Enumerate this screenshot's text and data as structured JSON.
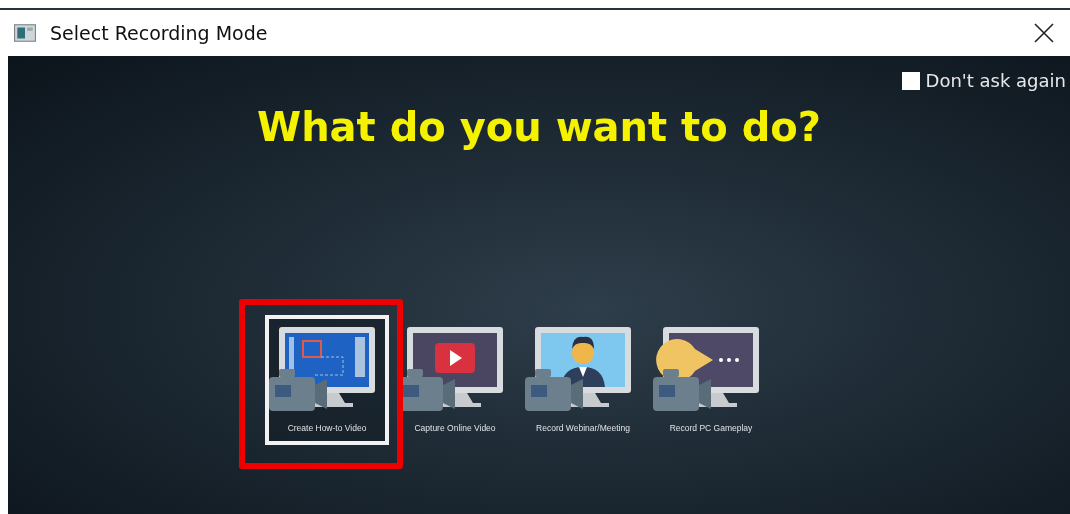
{
  "window": {
    "title": "Select Recording Mode"
  },
  "dont_ask": {
    "label": "Don't ask again",
    "checked": false
  },
  "heading": "What do you want to do?",
  "modes": [
    {
      "label": "Create How-to Video",
      "kind": "howto",
      "selected": true,
      "highlighted": true
    },
    {
      "label": "Capture Online Video",
      "kind": "online",
      "selected": false,
      "highlighted": false
    },
    {
      "label": "Record Webinar/Meeting",
      "kind": "webinar",
      "selected": false,
      "highlighted": false
    },
    {
      "label": "Record PC Gameplay",
      "kind": "gameplay",
      "selected": false,
      "highlighted": false
    }
  ]
}
